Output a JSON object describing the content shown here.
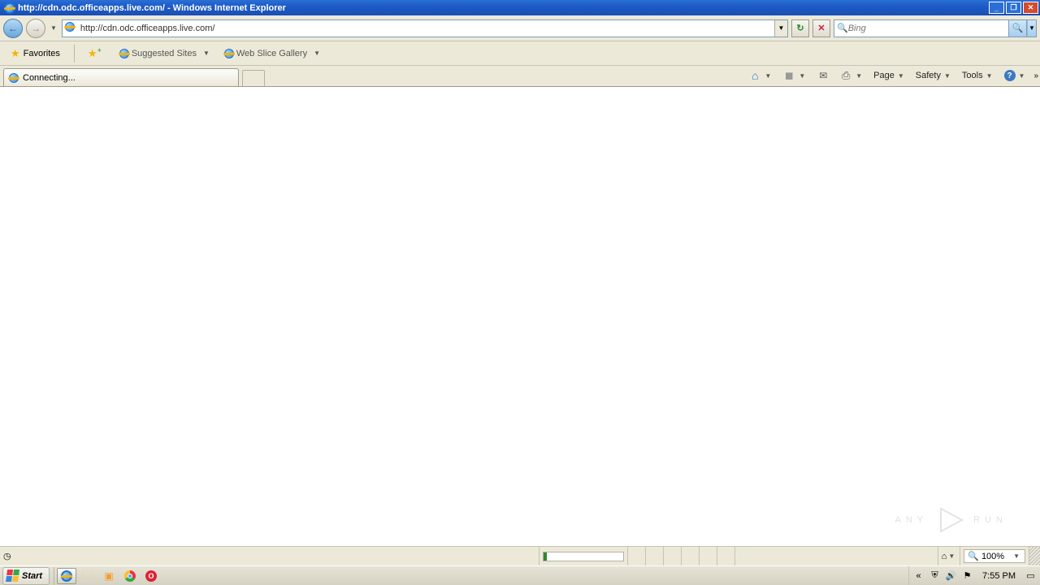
{
  "window": {
    "title": "http://cdn.odc.officeapps.live.com/ - Windows Internet Explorer"
  },
  "address": {
    "url": "http://cdn.odc.officeapps.live.com/"
  },
  "search": {
    "placeholder": "Bing"
  },
  "favorites": {
    "label": "Favorites",
    "suggested": "Suggested Sites",
    "webslice": "Web Slice Gallery"
  },
  "tab": {
    "label": "Connecting..."
  },
  "commands": {
    "page": "Page",
    "safety": "Safety",
    "tools": "Tools"
  },
  "status": {
    "zoom": "100%"
  },
  "taskbar": {
    "start": "Start",
    "clock": "7:55 PM"
  },
  "watermark": {
    "left": "ANY",
    "right": "RUN"
  }
}
